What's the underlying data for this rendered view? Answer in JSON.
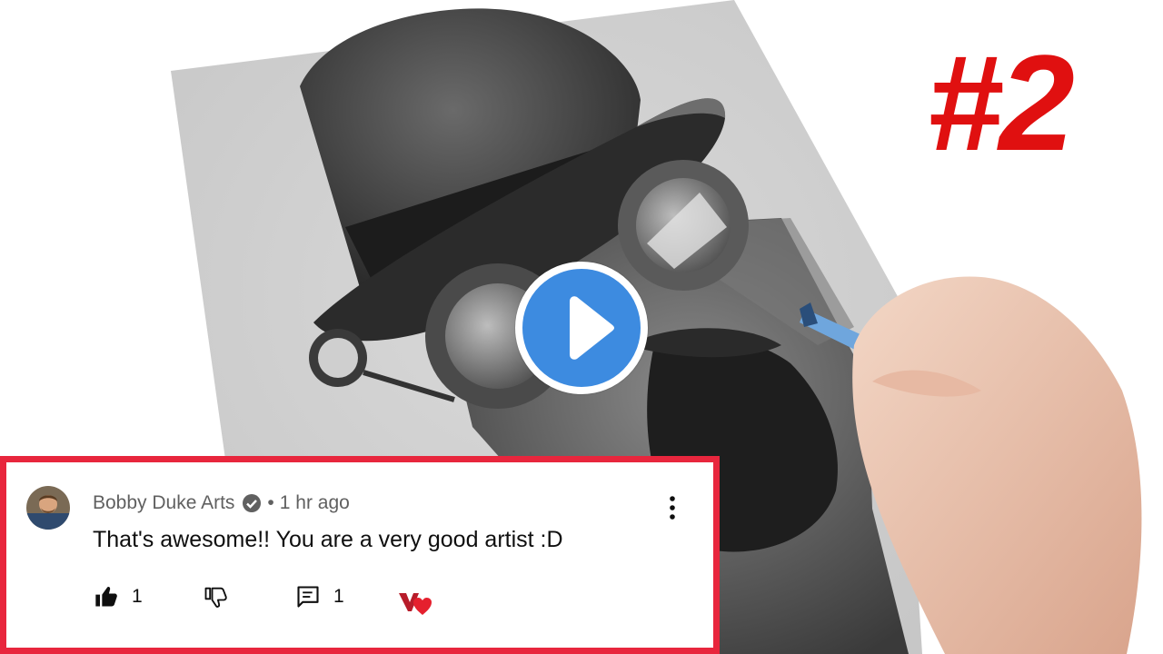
{
  "thumbnail": {
    "episode_label": "#2",
    "play_icon": "play-icon"
  },
  "comment": {
    "author": "Bobby Duke Arts",
    "verified_icon": "verified-check-icon",
    "separator": "•",
    "time": "1 hr ago",
    "text": "That's awesome!! You are a very good artist :D",
    "more_icon": "vertical-dots-icon",
    "likes": "1",
    "like_icon": "thumbs-up-filled-icon",
    "dislike_icon": "thumbs-down-icon",
    "replies": "1",
    "reply_icon": "reply-comment-icon",
    "creator_heart_icon": "creator-heart-icon"
  },
  "colors": {
    "badge_red": "#e01010",
    "frame_red": "#e8263d",
    "play_blue": "#3d8be0",
    "heart_red": "#e5202e"
  }
}
